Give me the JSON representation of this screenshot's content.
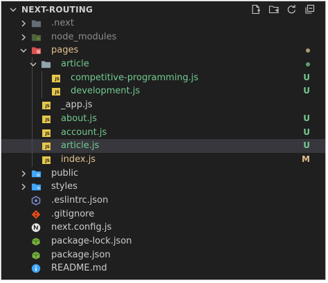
{
  "explorer": {
    "title": "NEXT-ROUTING",
    "actions": [
      "new-file-icon",
      "new-folder-icon",
      "refresh-icon",
      "collapse-all-icon"
    ]
  },
  "tree": [
    {
      "label": ".next",
      "kind": "folder",
      "icon": "folder-icon",
      "expanded": false,
      "depth": 0,
      "dimmed": true
    },
    {
      "label": "node_modules",
      "kind": "folder",
      "icon": "node-folder-icon",
      "expanded": false,
      "depth": 0,
      "dimmed": true
    },
    {
      "label": "pages",
      "kind": "folder",
      "icon": "pages-folder-icon",
      "expanded": true,
      "depth": 0,
      "status": "dot",
      "color": "#e2c08d"
    },
    {
      "label": "article",
      "kind": "folder",
      "icon": "folder-icon",
      "expanded": true,
      "depth": 1,
      "status": "dot",
      "color": "#73c991"
    },
    {
      "label": "competitive-programming.js",
      "kind": "file",
      "icon": "js-file-icon",
      "depth": 2,
      "badge": "U",
      "color": "#73c991"
    },
    {
      "label": "development.js",
      "kind": "file",
      "icon": "js-file-icon",
      "depth": 2,
      "badge": "U",
      "color": "#73c991"
    },
    {
      "label": "_app.js",
      "kind": "file",
      "icon": "js-file-icon",
      "depth": 1
    },
    {
      "label": "about.js",
      "kind": "file",
      "icon": "js-file-icon",
      "depth": 1,
      "badge": "U",
      "color": "#73c991"
    },
    {
      "label": "account.js",
      "kind": "file",
      "icon": "js-file-icon",
      "depth": 1,
      "badge": "U",
      "color": "#73c991"
    },
    {
      "label": "article.js",
      "kind": "file",
      "icon": "js-file-icon",
      "depth": 1,
      "badge": "U",
      "color": "#73c991",
      "selected": true
    },
    {
      "label": "index.js",
      "kind": "file",
      "icon": "js-file-icon",
      "depth": 1,
      "badge": "M",
      "color": "#e2c08d"
    },
    {
      "label": "public",
      "kind": "folder",
      "icon": "public-folder-icon",
      "expanded": false,
      "depth": 0
    },
    {
      "label": "styles",
      "kind": "folder",
      "icon": "styles-folder-icon",
      "expanded": false,
      "depth": 0
    },
    {
      "label": ".eslintrc.json",
      "kind": "file",
      "icon": "eslint-icon",
      "depth": 0
    },
    {
      "label": ".gitignore",
      "kind": "file",
      "icon": "git-icon",
      "depth": 0
    },
    {
      "label": "next.config.js",
      "kind": "file",
      "icon": "next-icon",
      "depth": 0
    },
    {
      "label": "package-lock.json",
      "kind": "file",
      "icon": "npm-package-icon",
      "depth": 0
    },
    {
      "label": "package.json",
      "kind": "file",
      "icon": "npm-package-icon",
      "depth": 0
    },
    {
      "label": "README.md",
      "kind": "file",
      "icon": "info-icon",
      "depth": 0
    }
  ]
}
